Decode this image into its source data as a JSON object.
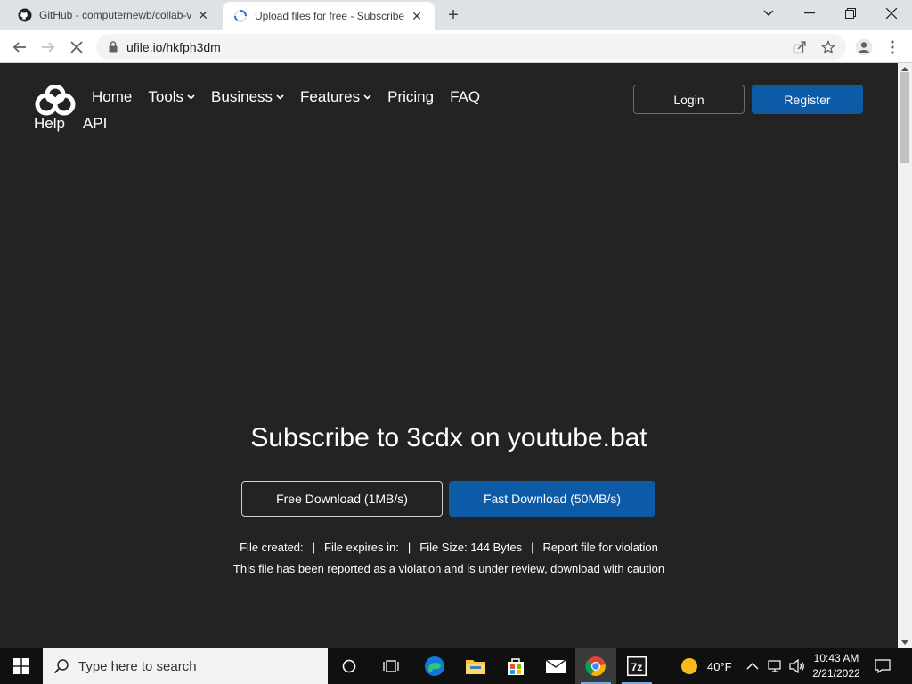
{
  "browser": {
    "tabs": [
      {
        "title": "GitHub - computernewb/collab-v",
        "favicon": "github-icon",
        "active": false
      },
      {
        "title": "Upload files for free - Subscribe t",
        "favicon": "loading-spinner-icon",
        "active": true
      }
    ],
    "url": "ufile.io/hkfph3dm"
  },
  "site": {
    "nav": [
      {
        "label": "Home",
        "has_dropdown": false
      },
      {
        "label": "Tools",
        "has_dropdown": true
      },
      {
        "label": "Business",
        "has_dropdown": true
      },
      {
        "label": "Features",
        "has_dropdown": true
      },
      {
        "label": "Pricing",
        "has_dropdown": false
      },
      {
        "label": "FAQ",
        "has_dropdown": false
      }
    ],
    "nav_row2": [
      {
        "label": "Help"
      },
      {
        "label": "API"
      }
    ],
    "login_label": "Login",
    "register_label": "Register"
  },
  "download": {
    "headline": "Subscribe to 3cdx on youtube.bat",
    "free_label": "Free Download (1MB/s)",
    "fast_label": "Fast Download (50MB/s)",
    "file_created": "File created:",
    "file_expires": "File expires in:",
    "file_size": "File Size: 144 Bytes",
    "report": "Report file for violation",
    "warning": "This file has been reported as a violation and is under review, download with caution"
  },
  "taskbar": {
    "search_placeholder": "Type here to search",
    "weather": "40°F",
    "time": "10:43 AM",
    "date": "2/21/2022"
  },
  "colors": {
    "page_bg": "#232323",
    "accent_blue": "#0d5aa7",
    "tabstrip_bg": "#dee1e6",
    "taskbar_bg": "#101010"
  }
}
